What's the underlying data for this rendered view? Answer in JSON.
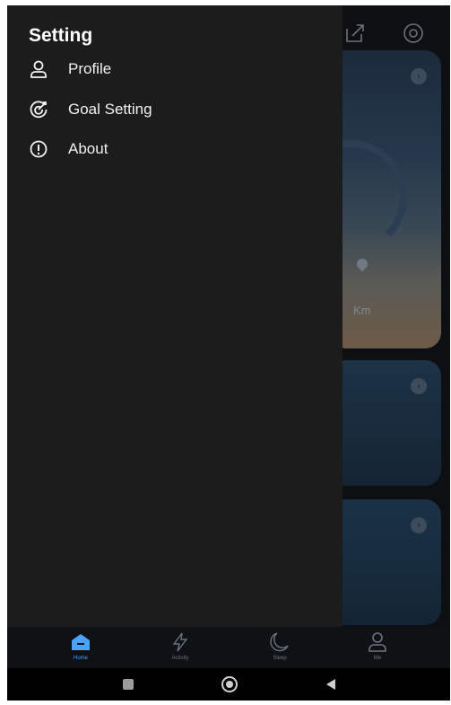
{
  "drawer": {
    "title": "Setting",
    "items": [
      {
        "label": "Profile",
        "icon": "person-icon"
      },
      {
        "label": "Goal Setting",
        "icon": "target-icon"
      },
      {
        "label": "About",
        "icon": "info-icon"
      }
    ]
  },
  "main": {
    "card1": {
      "unit_label": "Km"
    }
  },
  "bottom_nav": {
    "items": [
      {
        "label": "Home",
        "icon": "home-icon",
        "active": true
      },
      {
        "label": "Activity",
        "icon": "lightning-icon",
        "active": false
      },
      {
        "label": "Sleep",
        "icon": "moon-icon",
        "active": false
      },
      {
        "label": "Me",
        "icon": "person-icon",
        "active": false
      }
    ]
  },
  "colors": {
    "accent": "#4aa3ff",
    "drawer_bg": "#1c1c1d",
    "screen_bg": "#0d0f12"
  }
}
